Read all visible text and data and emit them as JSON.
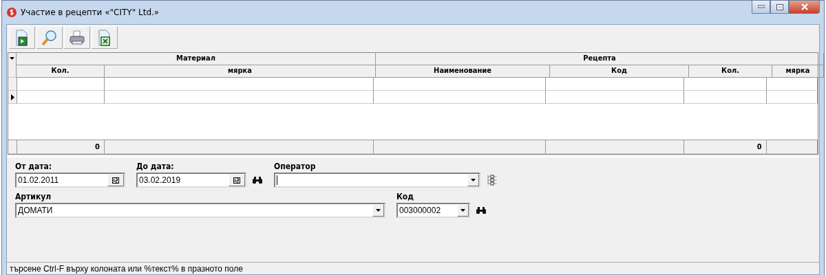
{
  "window": {
    "title": "Участие в рецепти «\"CITY\" Ltd.»"
  },
  "toolbar": [
    {
      "kind": "import"
    },
    {
      "kind": "search"
    },
    {
      "kind": "print"
    },
    {
      "kind": "excel"
    }
  ],
  "grid": {
    "groups": [
      {
        "label": "Материал",
        "columns": [
          {
            "label": "Кол.",
            "total": "0"
          },
          {
            "label": "мярка"
          }
        ]
      },
      {
        "label": "Рецепта",
        "columns": [
          {
            "label": "Наименование"
          },
          {
            "label": "Код"
          },
          {
            "label": "Кол.",
            "total": "0"
          },
          {
            "label": "мярка"
          }
        ]
      }
    ],
    "rows": [
      {
        "current": false
      },
      {
        "current": true
      }
    ]
  },
  "filters": {
    "from_date": {
      "label": "От дата:",
      "value": "01.02.2011"
    },
    "to_date": {
      "label": "До дата:",
      "value": "03.02.2019"
    },
    "operator": {
      "label": "Оператор"
    },
    "article": {
      "label": "Артикул",
      "value": "ДОМАТИ"
    },
    "code": {
      "label": "Код",
      "value": "003000002"
    }
  },
  "status_bar": "търсене Ctrl-F върху колоната или %текст% в празното поле"
}
